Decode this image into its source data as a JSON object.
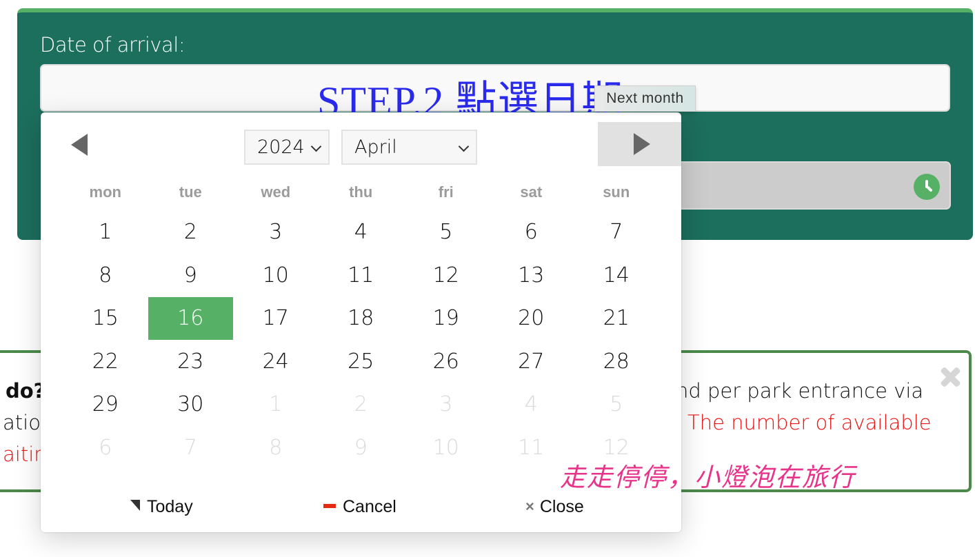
{
  "panel": {
    "date_label": "Date of arrival:",
    "date_value": "",
    "step_overlay": "STEP.2 點選日期",
    "time_value": "",
    "accent_color": "#56b066",
    "panel_color": "#1c6e5d"
  },
  "calendar": {
    "year": "2024",
    "month": "April",
    "prev_label": "Previous month",
    "next_tooltip": "Next month",
    "weekdays": [
      "mon",
      "tue",
      "wed",
      "thu",
      "fri",
      "sat",
      "sun"
    ],
    "weeks": [
      [
        {
          "d": "1"
        },
        {
          "d": "2"
        },
        {
          "d": "3"
        },
        {
          "d": "4"
        },
        {
          "d": "5"
        },
        {
          "d": "6"
        },
        {
          "d": "7"
        }
      ],
      [
        {
          "d": "8"
        },
        {
          "d": "9"
        },
        {
          "d": "10"
        },
        {
          "d": "11"
        },
        {
          "d": "12"
        },
        {
          "d": "13"
        },
        {
          "d": "14"
        }
      ],
      [
        {
          "d": "15"
        },
        {
          "d": "16",
          "selected": true
        },
        {
          "d": "17"
        },
        {
          "d": "18"
        },
        {
          "d": "19"
        },
        {
          "d": "20"
        },
        {
          "d": "21"
        }
      ],
      [
        {
          "d": "22"
        },
        {
          "d": "23"
        },
        {
          "d": "24"
        },
        {
          "d": "25"
        },
        {
          "d": "26"
        },
        {
          "d": "27"
        },
        {
          "d": "28"
        }
      ],
      [
        {
          "d": "29"
        },
        {
          "d": "30"
        },
        {
          "d": "1",
          "other": true
        },
        {
          "d": "2",
          "other": true
        },
        {
          "d": "3",
          "other": true
        },
        {
          "d": "4",
          "other": true
        },
        {
          "d": "5",
          "other": true
        }
      ],
      [
        {
          "d": "6",
          "other": true
        },
        {
          "d": "7",
          "other": true
        },
        {
          "d": "8",
          "other": true
        },
        {
          "d": "9",
          "other": true
        },
        {
          "d": "10",
          "other": true
        },
        {
          "d": "11",
          "other": true
        },
        {
          "d": "12",
          "other": true
        }
      ]
    ],
    "selected_day": "16",
    "footer": {
      "today": "Today",
      "cancel": "Cancel",
      "close": "Close"
    }
  },
  "info_box": {
    "left_line1": "do?",
    "left_line2": "ation",
    "left_line3": "aitin",
    "right_line1": "nd per park entrance via",
    "right_line2": ": The number of available"
  },
  "watermark": "走走停停，小燈泡在旅行"
}
